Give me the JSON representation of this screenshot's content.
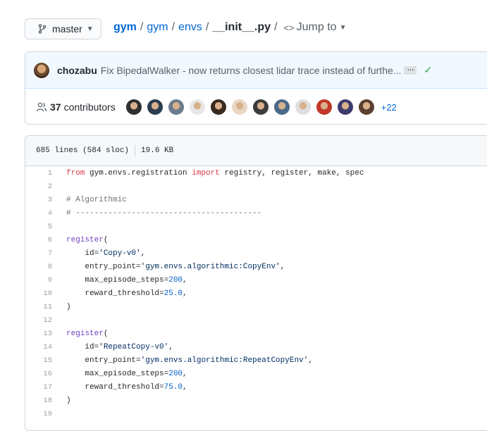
{
  "branch": {
    "name": "master",
    "icon": "git-branch-icon"
  },
  "breadcrumb": {
    "repo": "gym",
    "parts": [
      "gym",
      "envs"
    ],
    "separator": "/",
    "file": "__init__.py",
    "jump_to": "Jump to"
  },
  "commit": {
    "author": "chozabu",
    "message": "Fix BipedalWalker - now returns closest lidar trace instead of furthe...",
    "ellipsis": "…",
    "status_icon": "check-icon"
  },
  "contributors": {
    "count": "37",
    "label": "contributors",
    "more": "+22",
    "avatar_colors": [
      "#2f2f2f",
      "#2c3e50",
      "#6b7b8c",
      "#e8e8e8",
      "#3a2a1f",
      "#e9d6c4",
      "#3b3b3b",
      "#4a6a8a",
      "#dedede",
      "#c0392b",
      "#3d3b6e",
      "#5a4030"
    ]
  },
  "file": {
    "lines_info": "685 lines (584 sloc)",
    "size": "19.6 KB"
  },
  "code_lines": [
    {
      "n": "1",
      "tokens": [
        [
          "kw",
          "from"
        ],
        [
          "pl",
          " gym.envs.registration "
        ],
        [
          "kw",
          "import"
        ],
        [
          "pl",
          " registry, register, make, spec"
        ]
      ]
    },
    {
      "n": "2",
      "tokens": []
    },
    {
      "n": "3",
      "tokens": [
        [
          "cm",
          "# Algorithmic"
        ]
      ]
    },
    {
      "n": "4",
      "tokens": [
        [
          "cm",
          "# ----------------------------------------"
        ]
      ]
    },
    {
      "n": "5",
      "tokens": []
    },
    {
      "n": "6",
      "tokens": [
        [
          "nm",
          "register"
        ],
        [
          "pl",
          "("
        ]
      ]
    },
    {
      "n": "7",
      "tokens": [
        [
          "pl",
          "    id="
        ],
        [
          "str",
          "'Copy-v0'"
        ],
        [
          "pl",
          ","
        ]
      ]
    },
    {
      "n": "8",
      "tokens": [
        [
          "pl",
          "    entry_point="
        ],
        [
          "str",
          "'gym.envs.algorithmic:CopyEnv'"
        ],
        [
          "pl",
          ","
        ]
      ]
    },
    {
      "n": "9",
      "tokens": [
        [
          "pl",
          "    max_episode_steps="
        ],
        [
          "num",
          "200"
        ],
        [
          "pl",
          ","
        ]
      ]
    },
    {
      "n": "10",
      "tokens": [
        [
          "pl",
          "    reward_threshold="
        ],
        [
          "num",
          "25.0"
        ],
        [
          "pl",
          ","
        ]
      ]
    },
    {
      "n": "11",
      "tokens": [
        [
          "pl",
          ")"
        ]
      ]
    },
    {
      "n": "12",
      "tokens": []
    },
    {
      "n": "13",
      "tokens": [
        [
          "nm",
          "register"
        ],
        [
          "pl",
          "("
        ]
      ]
    },
    {
      "n": "14",
      "tokens": [
        [
          "pl",
          "    id="
        ],
        [
          "str",
          "'RepeatCopy-v0'"
        ],
        [
          "pl",
          ","
        ]
      ]
    },
    {
      "n": "15",
      "tokens": [
        [
          "pl",
          "    entry_point="
        ],
        [
          "str",
          "'gym.envs.algorithmic:RepeatCopyEnv'"
        ],
        [
          "pl",
          ","
        ]
      ]
    },
    {
      "n": "16",
      "tokens": [
        [
          "pl",
          "    max_episode_steps="
        ],
        [
          "num",
          "200"
        ],
        [
          "pl",
          ","
        ]
      ]
    },
    {
      "n": "17",
      "tokens": [
        [
          "pl",
          "    reward_threshold="
        ],
        [
          "num",
          "75.0"
        ],
        [
          "pl",
          ","
        ]
      ]
    },
    {
      "n": "18",
      "tokens": [
        [
          "pl",
          ")"
        ]
      ]
    },
    {
      "n": "19",
      "tokens": []
    }
  ]
}
